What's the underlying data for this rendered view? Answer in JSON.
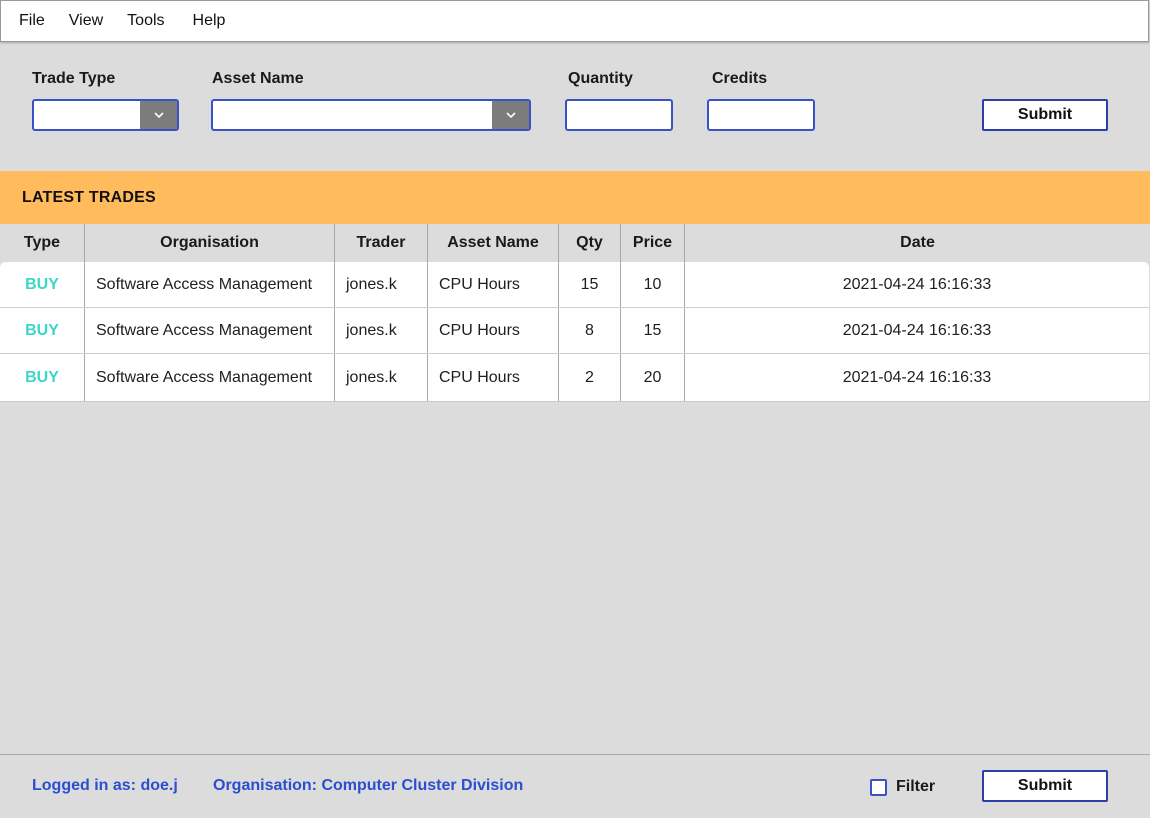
{
  "menu": [
    "File",
    "View",
    "Tools",
    "Help"
  ],
  "form": {
    "trade_type_label": "Trade Type",
    "trade_type_value": "",
    "asset_name_label": "Asset Name",
    "asset_name_value": "",
    "quantity_label": "Quantity",
    "quantity_value": "",
    "credits_label": "Credits",
    "credits_value": "",
    "submit_label": "Submit"
  },
  "section": {
    "title": "LATEST TRADES"
  },
  "table": {
    "columns": [
      "Type",
      "Organisation",
      "Trader",
      "Asset Name",
      "Qty",
      "Price",
      "Date"
    ],
    "rows": [
      {
        "type": "BUY",
        "organisation": "Software Access Management",
        "trader": "jones.k",
        "asset": "CPU Hours",
        "qty": "15",
        "price": "10",
        "date": "2021-04-24 16:16:33"
      },
      {
        "type": "BUY",
        "organisation": "Software Access Management",
        "trader": "jones.k",
        "asset": "CPU Hours",
        "qty": "8",
        "price": "15",
        "date": "2021-04-24 16:16:33"
      },
      {
        "type": "BUY",
        "organisation": "Software Access Management",
        "trader": "jones.k",
        "asset": "CPU Hours",
        "qty": "2",
        "price": "20",
        "date": "2021-04-24 16:16:33"
      }
    ]
  },
  "footer": {
    "logged_in": "Logged in as: doe.j",
    "organisation": "Organisation: Computer Cluster Division",
    "filter_label": "Filter",
    "filter_checked": false,
    "submit_label": "Submit"
  },
  "colors": {
    "accent": "#3a52c8",
    "section_bar": "#ffbb5c",
    "buy": "#3dd6c8",
    "footer_text": "#2a4fd0"
  },
  "icons": {
    "dropdown": "chevron-down-icon"
  }
}
